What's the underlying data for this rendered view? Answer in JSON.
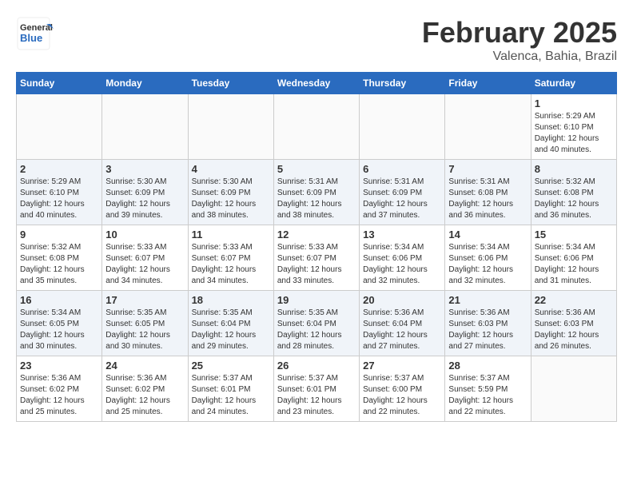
{
  "header": {
    "logo_line1": "General",
    "logo_line2": "Blue",
    "month_title": "February 2025",
    "location": "Valenca, Bahia, Brazil"
  },
  "days_of_week": [
    "Sunday",
    "Monday",
    "Tuesday",
    "Wednesday",
    "Thursday",
    "Friday",
    "Saturday"
  ],
  "weeks": [
    [
      {
        "day": "",
        "info": ""
      },
      {
        "day": "",
        "info": ""
      },
      {
        "day": "",
        "info": ""
      },
      {
        "day": "",
        "info": ""
      },
      {
        "day": "",
        "info": ""
      },
      {
        "day": "",
        "info": ""
      },
      {
        "day": "1",
        "info": "Sunrise: 5:29 AM\nSunset: 6:10 PM\nDaylight: 12 hours\nand 40 minutes."
      }
    ],
    [
      {
        "day": "2",
        "info": "Sunrise: 5:29 AM\nSunset: 6:10 PM\nDaylight: 12 hours\nand 40 minutes."
      },
      {
        "day": "3",
        "info": "Sunrise: 5:30 AM\nSunset: 6:09 PM\nDaylight: 12 hours\nand 39 minutes."
      },
      {
        "day": "4",
        "info": "Sunrise: 5:30 AM\nSunset: 6:09 PM\nDaylight: 12 hours\nand 38 minutes."
      },
      {
        "day": "5",
        "info": "Sunrise: 5:31 AM\nSunset: 6:09 PM\nDaylight: 12 hours\nand 38 minutes."
      },
      {
        "day": "6",
        "info": "Sunrise: 5:31 AM\nSunset: 6:09 PM\nDaylight: 12 hours\nand 37 minutes."
      },
      {
        "day": "7",
        "info": "Sunrise: 5:31 AM\nSunset: 6:08 PM\nDaylight: 12 hours\nand 36 minutes."
      },
      {
        "day": "8",
        "info": "Sunrise: 5:32 AM\nSunset: 6:08 PM\nDaylight: 12 hours\nand 36 minutes."
      }
    ],
    [
      {
        "day": "9",
        "info": "Sunrise: 5:32 AM\nSunset: 6:08 PM\nDaylight: 12 hours\nand 35 minutes."
      },
      {
        "day": "10",
        "info": "Sunrise: 5:33 AM\nSunset: 6:07 PM\nDaylight: 12 hours\nand 34 minutes."
      },
      {
        "day": "11",
        "info": "Sunrise: 5:33 AM\nSunset: 6:07 PM\nDaylight: 12 hours\nand 34 minutes."
      },
      {
        "day": "12",
        "info": "Sunrise: 5:33 AM\nSunset: 6:07 PM\nDaylight: 12 hours\nand 33 minutes."
      },
      {
        "day": "13",
        "info": "Sunrise: 5:34 AM\nSunset: 6:06 PM\nDaylight: 12 hours\nand 32 minutes."
      },
      {
        "day": "14",
        "info": "Sunrise: 5:34 AM\nSunset: 6:06 PM\nDaylight: 12 hours\nand 32 minutes."
      },
      {
        "day": "15",
        "info": "Sunrise: 5:34 AM\nSunset: 6:06 PM\nDaylight: 12 hours\nand 31 minutes."
      }
    ],
    [
      {
        "day": "16",
        "info": "Sunrise: 5:34 AM\nSunset: 6:05 PM\nDaylight: 12 hours\nand 30 minutes."
      },
      {
        "day": "17",
        "info": "Sunrise: 5:35 AM\nSunset: 6:05 PM\nDaylight: 12 hours\nand 30 minutes."
      },
      {
        "day": "18",
        "info": "Sunrise: 5:35 AM\nSunset: 6:04 PM\nDaylight: 12 hours\nand 29 minutes."
      },
      {
        "day": "19",
        "info": "Sunrise: 5:35 AM\nSunset: 6:04 PM\nDaylight: 12 hours\nand 28 minutes."
      },
      {
        "day": "20",
        "info": "Sunrise: 5:36 AM\nSunset: 6:04 PM\nDaylight: 12 hours\nand 27 minutes."
      },
      {
        "day": "21",
        "info": "Sunrise: 5:36 AM\nSunset: 6:03 PM\nDaylight: 12 hours\nand 27 minutes."
      },
      {
        "day": "22",
        "info": "Sunrise: 5:36 AM\nSunset: 6:03 PM\nDaylight: 12 hours\nand 26 minutes."
      }
    ],
    [
      {
        "day": "23",
        "info": "Sunrise: 5:36 AM\nSunset: 6:02 PM\nDaylight: 12 hours\nand 25 minutes."
      },
      {
        "day": "24",
        "info": "Sunrise: 5:36 AM\nSunset: 6:02 PM\nDaylight: 12 hours\nand 25 minutes."
      },
      {
        "day": "25",
        "info": "Sunrise: 5:37 AM\nSunset: 6:01 PM\nDaylight: 12 hours\nand 24 minutes."
      },
      {
        "day": "26",
        "info": "Sunrise: 5:37 AM\nSunset: 6:01 PM\nDaylight: 12 hours\nand 23 minutes."
      },
      {
        "day": "27",
        "info": "Sunrise: 5:37 AM\nSunset: 6:00 PM\nDaylight: 12 hours\nand 22 minutes."
      },
      {
        "day": "28",
        "info": "Sunrise: 5:37 AM\nSunset: 5:59 PM\nDaylight: 12 hours\nand 22 minutes."
      },
      {
        "day": "",
        "info": ""
      }
    ]
  ]
}
